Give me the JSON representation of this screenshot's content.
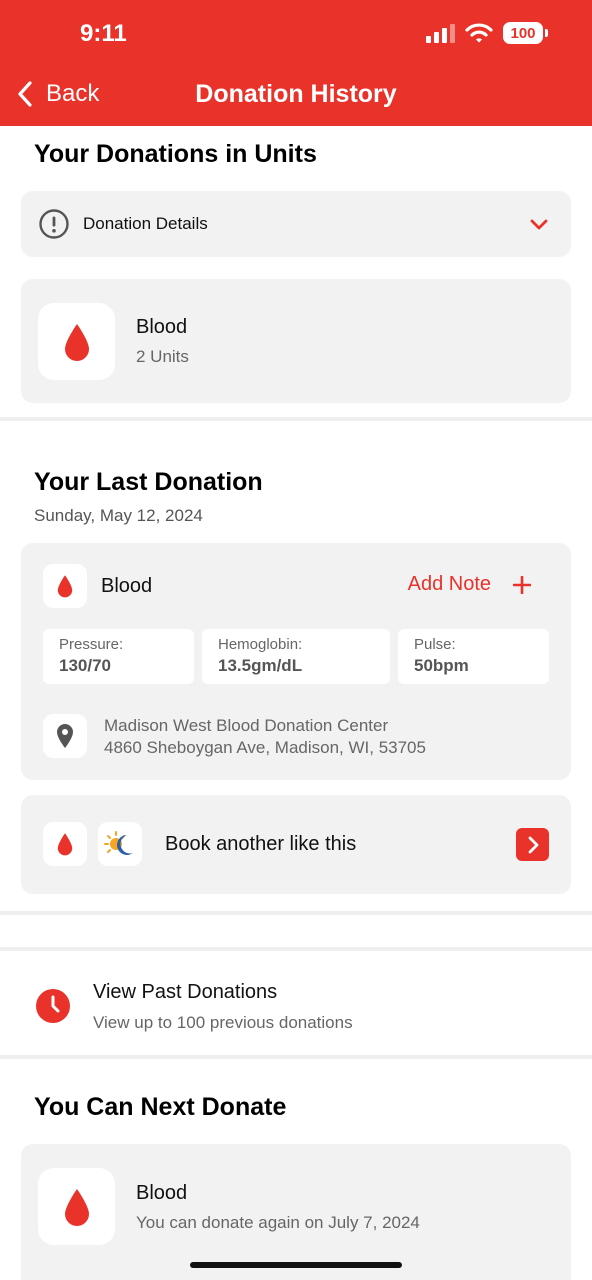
{
  "status_bar": {
    "time": "9:11",
    "battery": "100"
  },
  "nav": {
    "back_label": "Back",
    "title": "Donation History"
  },
  "units_section": {
    "heading": "Your Donations in Units",
    "details_label": "Donation Details",
    "item": {
      "name": "Blood",
      "units": "2 Units"
    }
  },
  "last_donation": {
    "heading": "Your Last Donation",
    "date": "Sunday, May 12, 2024",
    "type": "Blood",
    "add_note_label": "Add Note",
    "vitals": [
      {
        "label": "Pressure:",
        "value": "130/70"
      },
      {
        "label": "Hemoglobin:",
        "value": "13.5gm/dL"
      },
      {
        "label": "Pulse:",
        "value": "50bpm"
      }
    ],
    "location": {
      "name": "Madison West Blood Donation Center",
      "address": "4860 Sheboygan Ave, Madison, WI, 53705"
    },
    "book_label": "Book another like this"
  },
  "past_donations": {
    "title": "View Past Donations",
    "subtitle": "View up to 100 previous donations"
  },
  "next_donate": {
    "heading": "You Can Next Donate",
    "item": {
      "name": "Blood",
      "detail": "You can donate again on July 7, 2024"
    }
  },
  "colors": {
    "accent": "#e8322a",
    "card": "#f2f2f2"
  },
  "icons": [
    "signal-icon",
    "wifi-icon",
    "battery-icon",
    "chevron-left-icon",
    "info-icon",
    "chevron-down-icon",
    "blood-drop-icon",
    "plus-icon",
    "location-pin-icon",
    "day-night-icon",
    "chevron-right-icon",
    "clock-icon"
  ]
}
